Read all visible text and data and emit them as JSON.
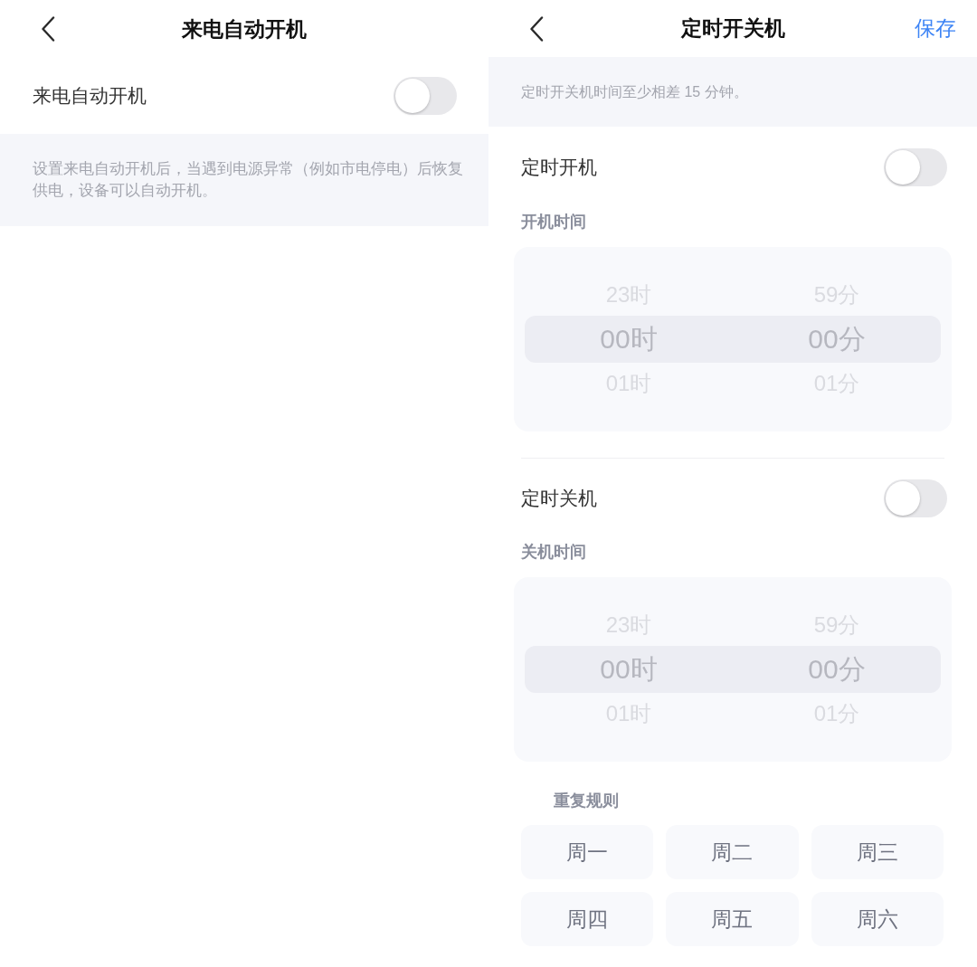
{
  "left_screen": {
    "title": "来电自动开机",
    "setting": {
      "label": "来电自动开机",
      "on": false
    },
    "note": "设置来电自动开机后，当遇到电源异常（例如市电停电）后恢复供电，设备可以自动开机。"
  },
  "right_screen": {
    "title": "定时开关机",
    "save_button": "保存",
    "note": "定时开关机时间至少相差 15 分钟。",
    "schedules": [
      {
        "label": "定时开机",
        "on": false,
        "time_label": "开机时间",
        "picker_rows": [
          {
            "hour": "23时",
            "minute": "59分",
            "selected": false
          },
          {
            "hour": "00时",
            "minute": "00分",
            "selected": true
          },
          {
            "hour": "01时",
            "minute": "01分",
            "selected": false
          }
        ]
      },
      {
        "label": "定时关机",
        "on": false,
        "time_label": "关机时间",
        "picker_rows": [
          {
            "hour": "23时",
            "minute": "59分",
            "selected": false
          },
          {
            "hour": "00时",
            "minute": "00分",
            "selected": true
          },
          {
            "hour": "01时",
            "minute": "01分",
            "selected": false
          }
        ]
      }
    ],
    "repeat": {
      "label": "重复规则",
      "days": [
        {
          "label": "周一",
          "selected": false
        },
        {
          "label": "周二",
          "selected": false
        },
        {
          "label": "周三",
          "selected": false
        },
        {
          "label": "周四",
          "selected": false
        },
        {
          "label": "周五",
          "selected": false
        },
        {
          "label": "周六",
          "selected": false
        }
      ]
    }
  }
}
